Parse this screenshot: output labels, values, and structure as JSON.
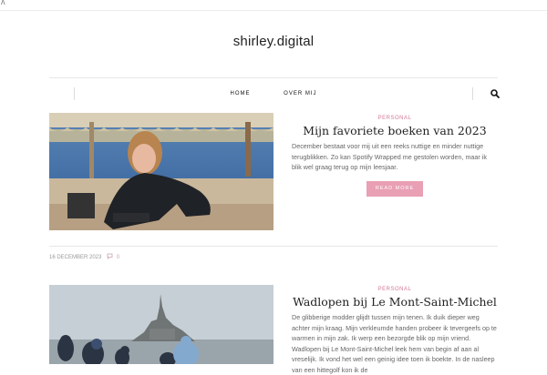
{
  "site": {
    "title": "shirley.digital"
  },
  "nav": {
    "items": [
      "HOME",
      "OVER MIJ"
    ]
  },
  "posts": [
    {
      "category": "PERSONAL",
      "title": "Mijn favoriete boeken van 2023",
      "excerpt": "December bestaat voor mij uit een reeks nuttige en minder nuttige terugblikken. Zo kan Spotify Wrapped me gestolen worden, maar ik blik wel graag terug op mijn leesjaar.",
      "button": "READ MORE",
      "date": "16 DECEMBER 2023",
      "comments": "0"
    },
    {
      "category": "PERSONAL",
      "title": "Wadlopen bij Le Mont-Saint-Michel",
      "excerpt": "De glibberige modder glijdt tussen mijn tenen. Ik duik dieper weg achter mijn kraag. Mijn verkleumde handen probeer ik tevergeefs op te warmen in mijn zak. Ik werp een bezorgde blik op mijn vriend. Wadlopen bij Le Mont-Saint-Michel leek hem van begin af aan al vreselijk. Ik vond het wel een geinig idee toen ik boekte. In de nasleep van een hittegolf kon ik de"
    }
  ],
  "icons": {
    "search": "search-icon",
    "comment": "comment-icon",
    "menu": "menu-glyph-icon"
  },
  "colors": {
    "accent": "#e99fb4",
    "category": "#d37a95"
  }
}
